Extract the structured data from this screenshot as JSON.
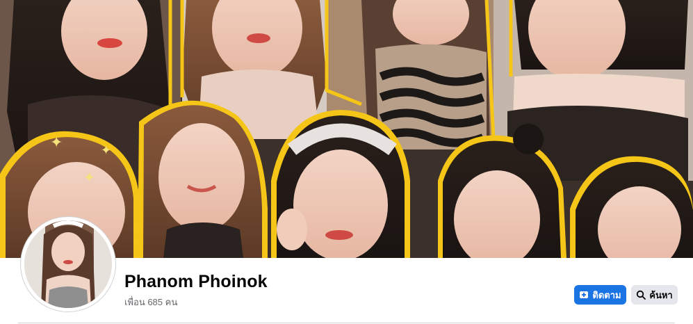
{
  "profile": {
    "name": "Phanom Phoinok",
    "friends_count": "เพื่อน 685 คน"
  },
  "actions": {
    "follow_label": "ติดตาม",
    "search_label": "ค้นหา"
  },
  "icons": {
    "follow": "follow-icon",
    "search": "search-icon"
  },
  "colors": {
    "primary_button": "#1b74e4",
    "secondary_button": "#e4e6eb",
    "cover_outline": "#f5c518"
  }
}
